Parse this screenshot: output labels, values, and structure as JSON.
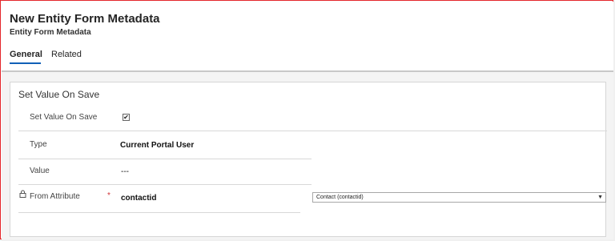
{
  "header": {
    "title": "New Entity Form Metadata",
    "subtitle": "Entity Form Metadata",
    "tabs": [
      {
        "label": "General",
        "active": true
      },
      {
        "label": "Related",
        "active": false
      }
    ]
  },
  "section": {
    "title": "Set Value On Save",
    "fields": {
      "set_value_on_save": {
        "label": "Set Value On Save",
        "checked": true,
        "check_glyph": "✔"
      },
      "type": {
        "label": "Type",
        "value": "Current Portal User"
      },
      "value": {
        "label": "Value",
        "value": "---"
      },
      "from_attribute": {
        "label": "From Attribute",
        "required_marker": "*",
        "value": "contactid",
        "select_value": "Contact (contactid)",
        "select_arrow": "▼"
      }
    }
  },
  "colors": {
    "accent": "#1160b7",
    "frame_border": "#e4262b",
    "required": "#d13438"
  }
}
